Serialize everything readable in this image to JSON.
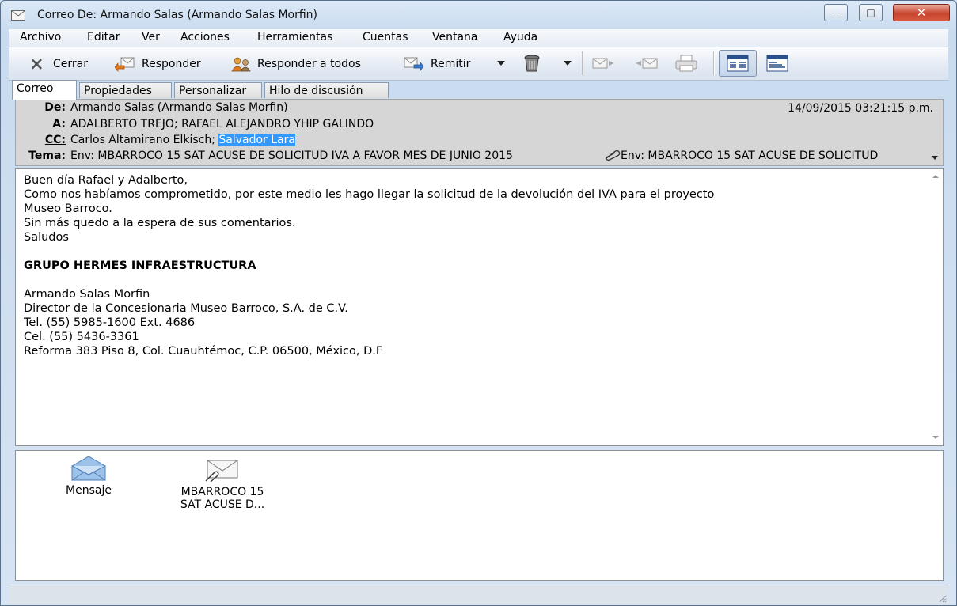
{
  "window": {
    "title": "Correo De: Armando Salas (Armando Salas Morfin)",
    "controls": {
      "minimize": "—",
      "maximize": "□",
      "close": "✕"
    }
  },
  "menu": [
    "Archivo",
    "Editar",
    "Ver",
    "Acciones",
    "Herramientas",
    "Cuentas",
    "Ventana",
    "Ayuda"
  ],
  "toolbar": {
    "close_label": "Cerrar",
    "reply_label": "Responder",
    "reply_all_label": "Responder a todos",
    "forward_label": "Remitir",
    "icons": {
      "close": "x-icon",
      "reply": "reply-icon",
      "reply_all": "reply-all-icon",
      "forward": "forward-icon",
      "delete": "trash-icon",
      "next": "next-message-icon",
      "previous": "previous-message-icon",
      "print": "printer-icon",
      "view_normal": "reading-view-icon",
      "view_headers": "header-view-icon"
    }
  },
  "tabs": [
    "Correo",
    "Propiedades",
    "Personalizar",
    "Hilo de discusión"
  ],
  "header": {
    "from_label": "De:",
    "from_value": "Armando Salas (Armando Salas Morfin)",
    "date": "14/09/2015 03:21:15 p.m.",
    "to_label": "A:",
    "to_value": "ADALBERTO TREJO; RAFAEL ALEJANDRO YHIP GALINDO",
    "cc_label": "CC:",
    "cc_value": "Carlos Altamirano Elkisch; ",
    "cc_selected": "Salvador Lara",
    "subject_label": "Tema:",
    "subject_value": "Env: MBARROCO 15 SAT ACUSE DE SOLICITUD IVA A FAVOR MES DE JUNIO 2015",
    "attachment_summary": "Env: MBARROCO 15 SAT ACUSE DE SOLICITUD"
  },
  "body": {
    "lines": [
      "Buen día Rafael y Adalberto,",
      "Como nos habíamos comprometido, por este medio les hago llegar la solicitud de la devolución del IVA para el proyecto",
      "Museo Barroco.",
      "Sin más quedo a la espera de sus comentarios.",
      "Saludos",
      "",
      "GRUPO HERMES INFRAESTRUCTURA",
      "",
      "Armando Salas Morfin",
      "Director de la Concesionaria Museo Barroco, S.A. de C.V.",
      "Tel.   (55) 5985-1600 Ext. 4686",
      "Cel.   (55) 5436-3361",
      "Reforma 383 Piso 8, Col. Cuauhtémoc, C.P. 06500, México, D.F"
    ]
  },
  "attachments": [
    {
      "line1": "Mensaje",
      "line2": ""
    },
    {
      "line1": "MBARROCO 15",
      "line2": "SAT ACUSE D..."
    }
  ]
}
